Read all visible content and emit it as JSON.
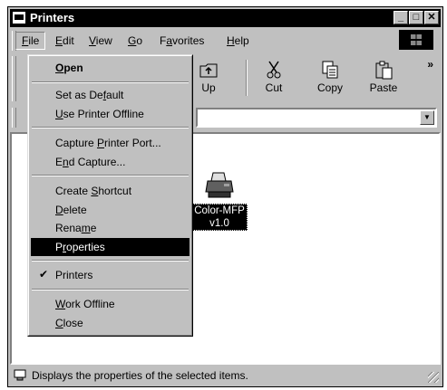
{
  "window": {
    "title": "Printers"
  },
  "menubar": {
    "items": [
      {
        "pre": "",
        "u": "F",
        "post": "ile"
      },
      {
        "pre": "",
        "u": "E",
        "post": "dit"
      },
      {
        "pre": "",
        "u": "V",
        "post": "iew"
      },
      {
        "pre": "",
        "u": "G",
        "post": "o"
      },
      {
        "pre": "F",
        "u": "a",
        "post": "vorites"
      },
      {
        "pre": "",
        "u": "H",
        "post": "elp"
      }
    ]
  },
  "toolbar": {
    "buttons": [
      "Up",
      "Cut",
      "Copy",
      "Paste"
    ],
    "more": "»"
  },
  "file_menu": {
    "open": {
      "pre": "",
      "u": "O",
      "post": "pen"
    },
    "set_default": {
      "pre": "Set as De",
      "u": "f",
      "post": "ault"
    },
    "use_offline": {
      "pre": "",
      "u": "U",
      "post": "se Printer Offline"
    },
    "capture_port": {
      "pre": "Capture ",
      "u": "P",
      "post": "rinter Port..."
    },
    "end_capture": {
      "pre": "E",
      "u": "n",
      "post": "d Capture..."
    },
    "create_shortcut": {
      "pre": "Create ",
      "u": "S",
      "post": "hortcut"
    },
    "delete": {
      "pre": "",
      "u": "D",
      "post": "elete"
    },
    "rename": {
      "pre": "Rena",
      "u": "m",
      "post": "e"
    },
    "properties": {
      "pre": "P",
      "u": "r",
      "post": "operties"
    },
    "printers": {
      "pre": "",
      "u": "",
      "post": "Printers"
    },
    "work_offline": {
      "pre": "",
      "u": "W",
      "post": "ork Offline"
    },
    "close": {
      "pre": "",
      "u": "C",
      "post": "lose"
    },
    "check_mark": "✔"
  },
  "content": {
    "printer_label_line1": "Color-MFP",
    "printer_label_line2": "v1.0"
  },
  "statusbar": {
    "text": "Displays the properties of the selected items."
  },
  "colors": {
    "chrome": "#c0c0c0",
    "highlight": "#000000",
    "window_bg": "#ffffff"
  },
  "icons": [
    "printers-folder-icon",
    "up-folder-icon",
    "scissors-icon",
    "copy-icon",
    "paste-icon",
    "printer-icon",
    "windows-logo-icon",
    "status-info-icon"
  ]
}
